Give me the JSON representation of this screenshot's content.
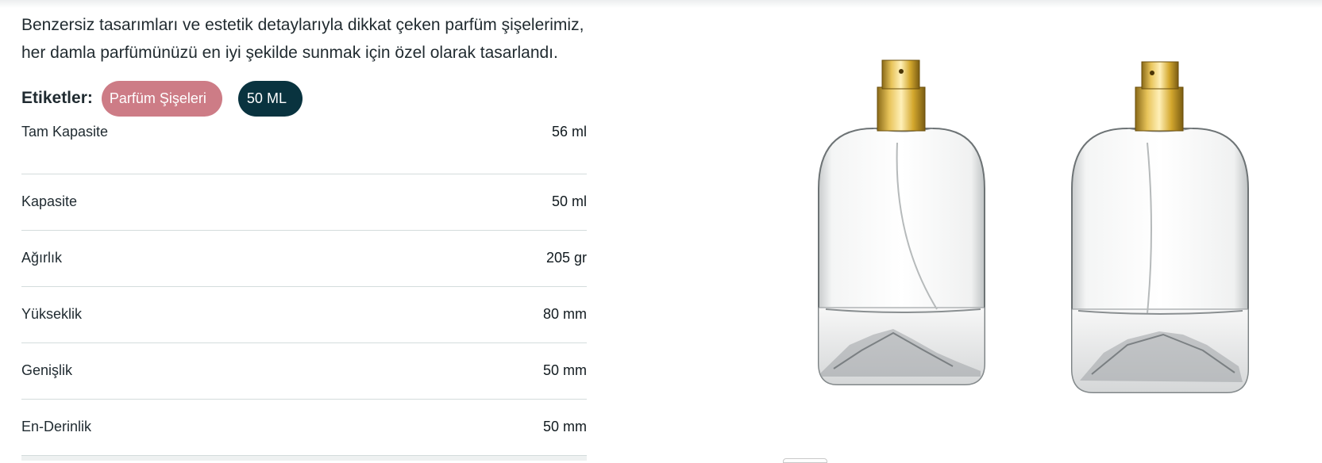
{
  "description": {
    "line1": "Benzersiz tasarımları ve estetik detaylarıyla dikkat çeken parfüm şişelerimiz,",
    "line2": "her damla parfümünüzü en iyi şekilde sunmak için özel olarak tasarlandı."
  },
  "tags": {
    "label": "Etiketler:",
    "items": [
      {
        "label": "Parfüm Şişeleri",
        "color": "#cd7c86"
      },
      {
        "label": "50 ML",
        "color": "#09333f"
      }
    ]
  },
  "specs": [
    {
      "label": "Tam Kapasite",
      "value": "56 ml"
    },
    {
      "label": "Kapasite",
      "value": "50 ml"
    },
    {
      "label": "Ağırlık",
      "value": "205 gr"
    },
    {
      "label": "Yükseklik",
      "value": "80 mm"
    },
    {
      "label": "Genişlik",
      "value": "50 mm"
    },
    {
      "label": "En-Derinlik",
      "value": "50 mm"
    }
  ],
  "product_image": {
    "icon": "perfume-bottles-image",
    "cap_color": "#d4a82e"
  }
}
